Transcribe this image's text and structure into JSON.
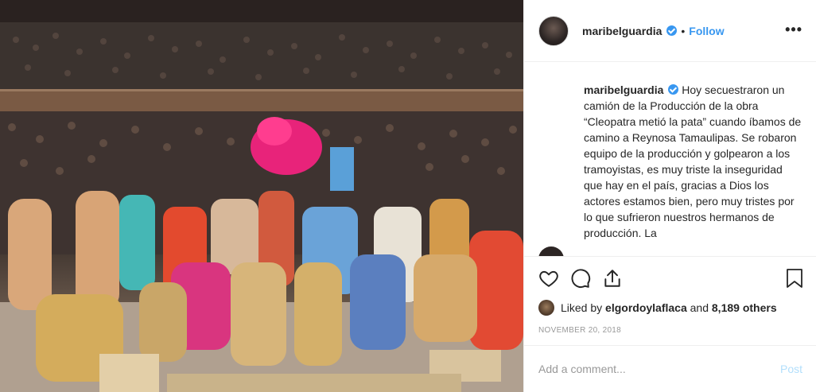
{
  "post": {
    "image_alt": "",
    "header": {
      "username": "maribelguardia",
      "separator": "•",
      "follow_label": "Follow",
      "more_label": "•••"
    },
    "caption": {
      "username": "maribelguardia",
      "text": "Hoy secuestraron un camión de la Producción de la obra “Cleopatra metió la pata” cuando íbamos de camino a Reynosa Tamaulipas. Se robaron equipo de la producción y golpearon a los tramoyistas, es muy triste la inseguridad que hay en el país, gracias a Dios los actores estamos bien, pero muy tristes por lo que sufrieron nuestros hermanos de producción. La"
    },
    "likes": {
      "prefix": "Liked by",
      "user": "elgordoylaflaca",
      "conjunction": "and",
      "others": "8,189 others"
    },
    "date": "NOVEMBER 20, 2018",
    "comment": {
      "placeholder": "Add a comment...",
      "post_label": "Post"
    },
    "icons": [
      "heart-icon",
      "comment-icon",
      "share-icon",
      "bookmark-icon",
      "verified-icon"
    ],
    "colors": {
      "link_blue": "#3897f0",
      "post_disabled": "#b2dffc",
      "muted": "#999999",
      "border": "#efefef"
    }
  }
}
